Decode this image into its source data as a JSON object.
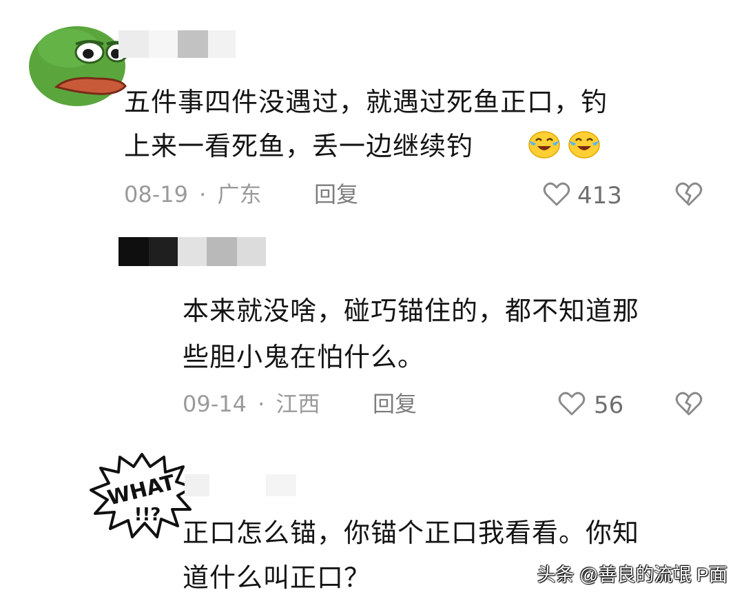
{
  "comments": [
    {
      "lines": [
        "五件事四件没遇过，就遇过死鱼正口，钓",
        "上来一看死鱼，丢一边继续钓"
      ],
      "emojis": [
        "laugh-cry",
        "laugh-cry"
      ],
      "date": "08-19",
      "sep": "·",
      "region": "广东",
      "reply_label": "回复",
      "likes": "413"
    },
    {
      "lines": [
        "本来就没啥，碰巧锚住的，都不知道那",
        "些胆小鬼在怕什么。"
      ],
      "date": "09-14",
      "sep": "·",
      "region": "江西",
      "reply_label": "回复",
      "likes": "56"
    },
    {
      "lines": [
        "正口怎么锚，你锚个正口我看看。你知",
        "道什么叫正口？"
      ],
      "sticker_text": [
        "WHAT",
        "!!?"
      ]
    }
  ],
  "watermark": "头条 @善良的流氓 P面",
  "colors": {
    "pepe_green": "#5aa63c",
    "lips": "#c85a3a",
    "emoji_yellow": "#ffcf33",
    "tear_blue": "#5fb4f0"
  }
}
